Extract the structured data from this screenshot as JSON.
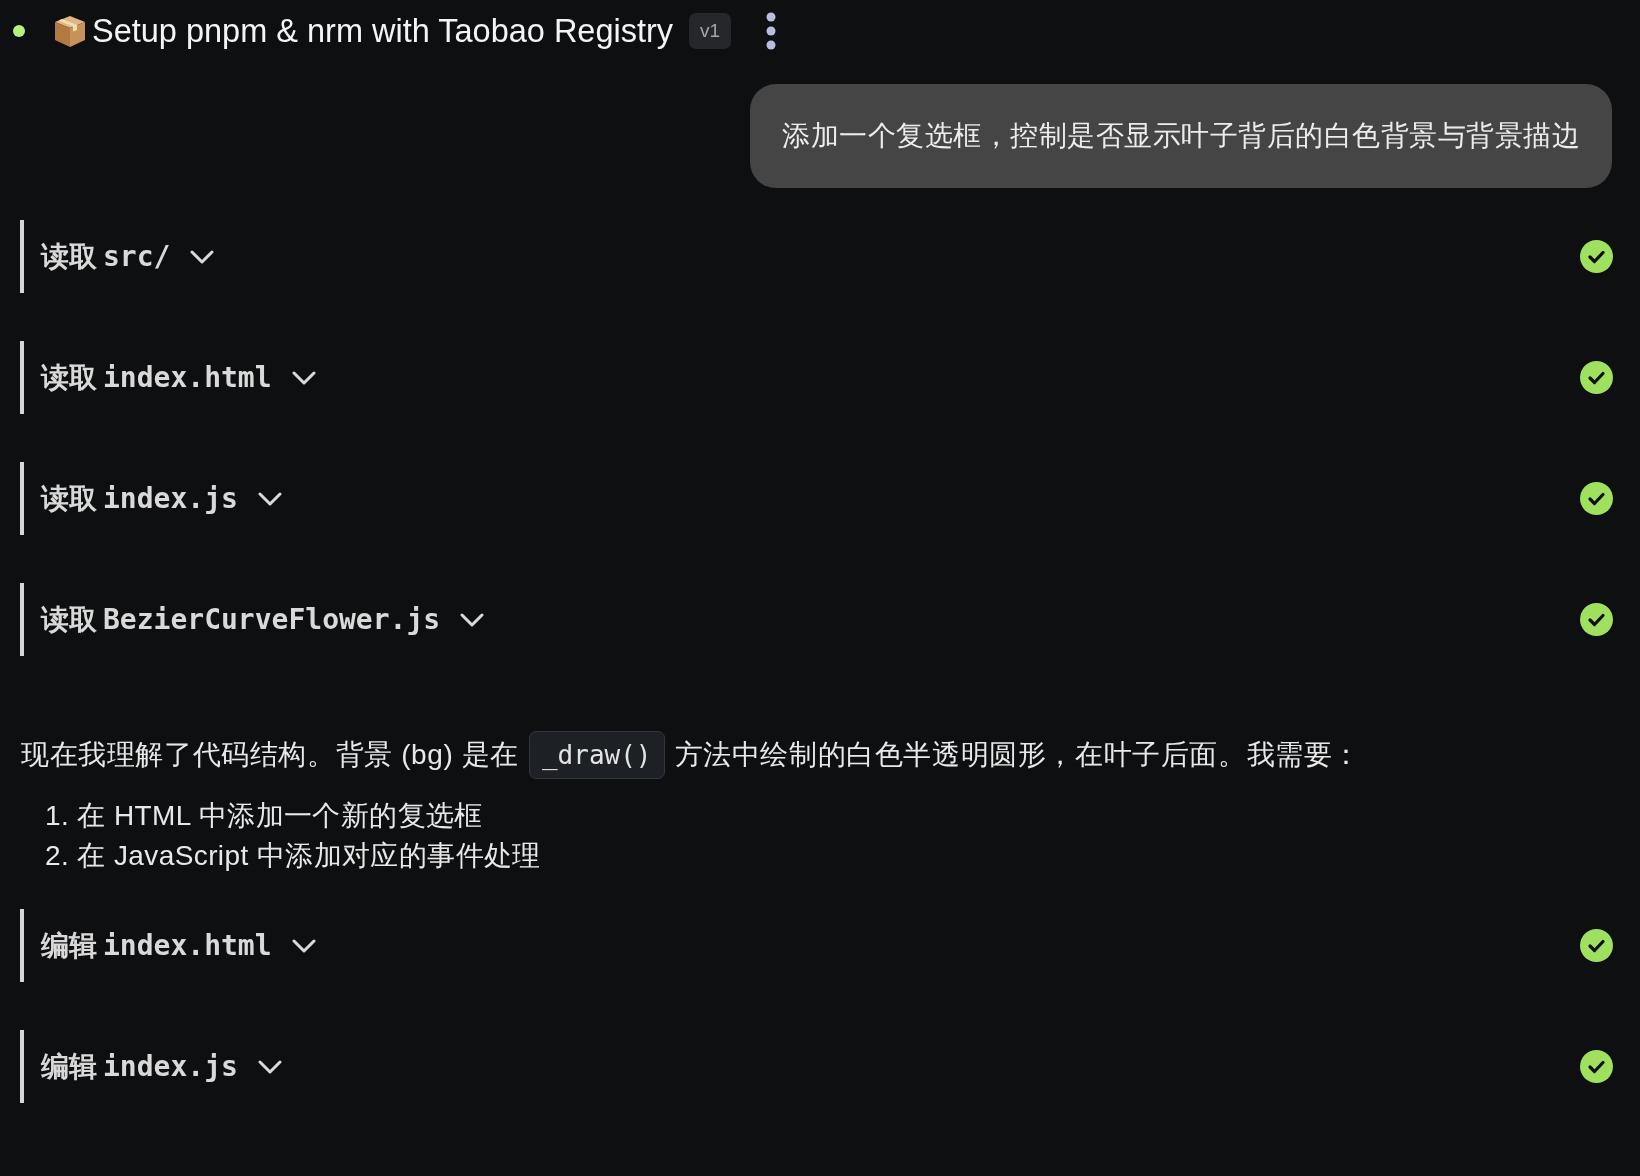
{
  "header": {
    "title": "Setup pnpm & nrm with Taobao Registry",
    "version": "v1"
  },
  "user_message": "添加一个复选框，控制是否显示叶子背后的白色背景与背景描边",
  "tool_calls": [
    {
      "action": "读取",
      "target": "src/",
      "expanded": false,
      "completed": true
    },
    {
      "action": "读取",
      "target": "index.html",
      "expanded": false,
      "completed": true
    },
    {
      "action": "读取",
      "target": "index.js",
      "expanded": false,
      "completed": true
    },
    {
      "action": "读取",
      "target": "BezierCurveFlower.js",
      "expanded": false,
      "completed": true
    }
  ],
  "assistant_message": {
    "parts": [
      {
        "kind": "text",
        "text": "现在我理解了代码结构。背景 (bg) 是在"
      },
      {
        "kind": "code",
        "text": "_draw()"
      },
      {
        "kind": "text",
        "text": "方法中绘制的白色半透明圆形，在叶子后面。我需要："
      }
    ],
    "steps": [
      {
        "number": "1.",
        "text": "在 HTML 中添加一个新的复选框"
      },
      {
        "number": "2.",
        "text": "在 JavaScript 中添加对应的事件处理"
      }
    ]
  },
  "edit_calls": [
    {
      "action": "编辑",
      "target": "index.html",
      "expanded": false,
      "completed": true
    },
    {
      "action": "编辑",
      "target": "index.js",
      "expanded": false,
      "completed": true
    }
  ]
}
